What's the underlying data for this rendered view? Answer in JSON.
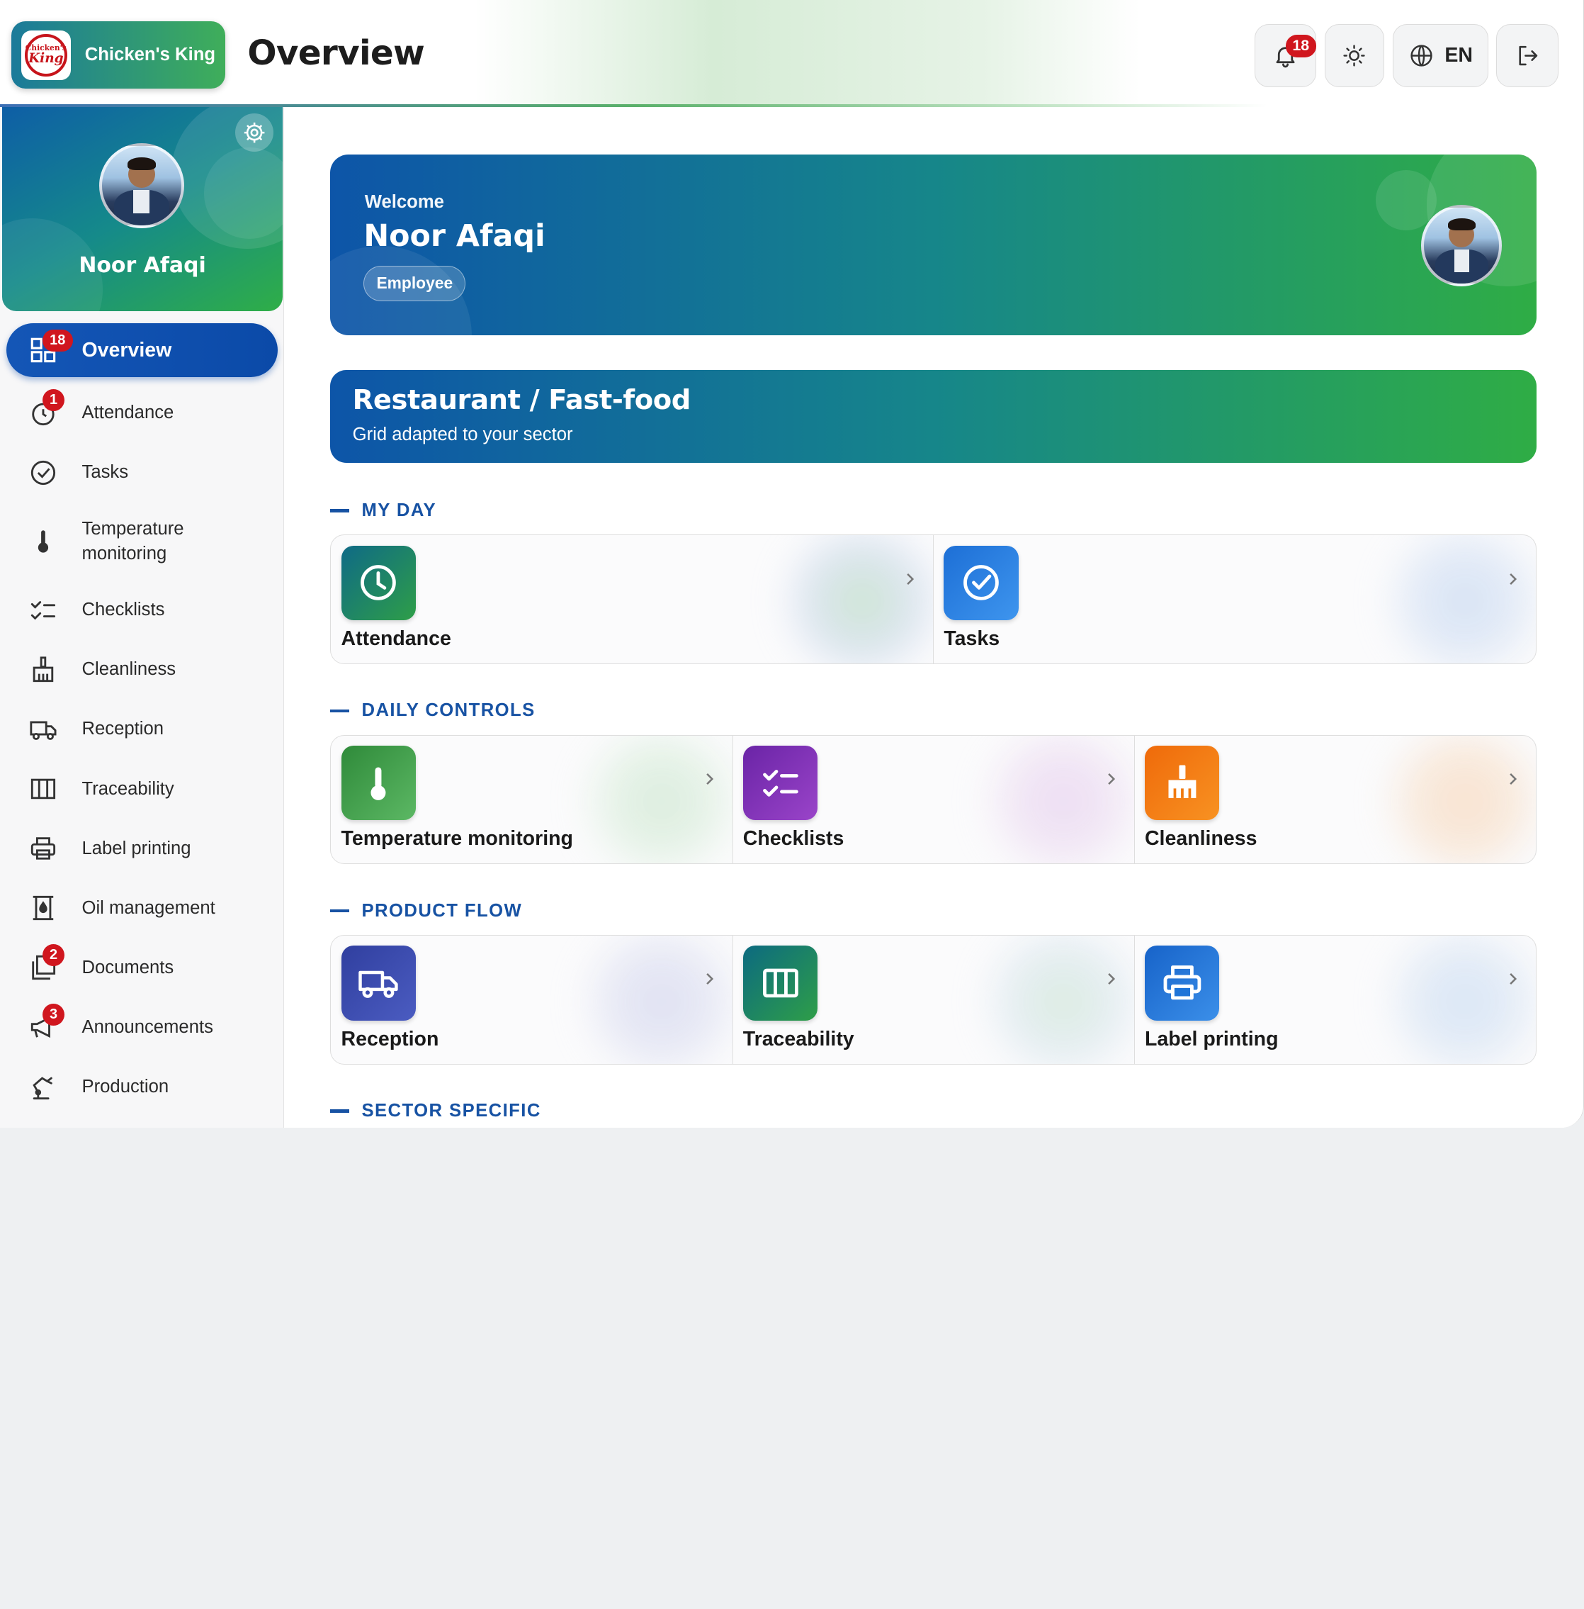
{
  "header": {
    "brand_name": "Chicken's King",
    "logo_text_top": "Chicken's",
    "logo_text_bottom": "King",
    "page_title": "Overview",
    "notifications_count": "18",
    "language": "EN",
    "icons": [
      "bell-icon",
      "sun-icon",
      "globe-icon",
      "logout-icon"
    ]
  },
  "profile": {
    "name": "Noor Afaqi"
  },
  "sidebar": {
    "items": [
      {
        "label": "Overview",
        "badge": "18",
        "icon": "dashboard-icon"
      },
      {
        "label": "Attendance",
        "badge": "1",
        "icon": "clock-icon"
      },
      {
        "label": "Tasks",
        "badge": "",
        "icon": "check-circle-icon"
      },
      {
        "label": "Temperature monitoring",
        "badge": "",
        "icon": "thermometer-icon"
      },
      {
        "label": "Checklists",
        "badge": "",
        "icon": "checklist-icon"
      },
      {
        "label": "Cleanliness",
        "badge": "",
        "icon": "broom-icon"
      },
      {
        "label": "Reception",
        "badge": "",
        "icon": "truck-icon"
      },
      {
        "label": "Traceability",
        "badge": "",
        "icon": "columns-icon"
      },
      {
        "label": "Label printing",
        "badge": "",
        "icon": "printer-icon"
      },
      {
        "label": "Oil management",
        "badge": "",
        "icon": "oil-icon"
      },
      {
        "label": "Documents",
        "badge": "2",
        "icon": "documents-icon"
      },
      {
        "label": "Announcements",
        "badge": "3",
        "icon": "megaphone-icon"
      },
      {
        "label": "Production",
        "badge": "",
        "icon": "robot-arm-icon"
      }
    ]
  },
  "welcome": {
    "greeting": "Welcome",
    "name": "Noor Afaqi",
    "role": "Employee"
  },
  "sector": {
    "title": "Restaurant / Fast-food",
    "subtitle": "Grid adapted to your sector"
  },
  "sections": [
    {
      "title": "MY DAY",
      "cards": [
        {
          "label": "Attendance",
          "icon": "clock-icon",
          "color": "#1e7e5a"
        },
        {
          "label": "Tasks",
          "icon": "check-circle-icon",
          "color": "#2c7be5"
        }
      ]
    },
    {
      "title": "DAILY CONTROLS",
      "cards": [
        {
          "label": "Temperature monitoring",
          "icon": "thermometer-icon",
          "color": "#3f9b47"
        },
        {
          "label": "Checklists",
          "icon": "checklist-icon",
          "color": "#7b2fb0"
        },
        {
          "label": "Cleanliness",
          "icon": "broom-icon",
          "color": "#f07a10"
        }
      ]
    },
    {
      "title": "PRODUCT FLOW",
      "cards": [
        {
          "label": "Reception",
          "icon": "truck-icon",
          "color": "#3949ab"
        },
        {
          "label": "Traceability",
          "icon": "columns-icon",
          "color": "#157b6a"
        },
        {
          "label": "Label printing",
          "icon": "printer-icon",
          "color": "#1e74d8"
        }
      ]
    },
    {
      "title": "SECTOR SPECIFIC",
      "cards": []
    }
  ]
}
